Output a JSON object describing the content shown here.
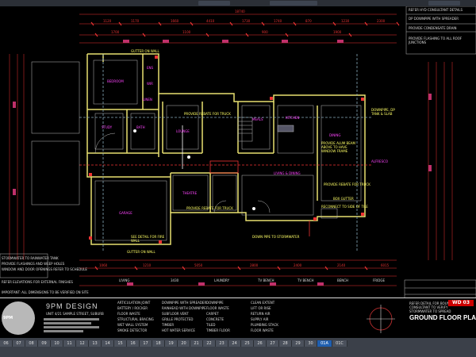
{
  "app": {
    "window_title": "GROUND FLOOR PLAN"
  },
  "dimensions": {
    "overall_top": "18740",
    "top_row": [
      "1120",
      "1170",
      "1660",
      "4410",
      "1730",
      "1740",
      "870",
      "1230",
      "2300",
      "1700",
      "1100",
      "900",
      "1900"
    ],
    "bottom_row": [
      "1060",
      "1210",
      "5050",
      "2800",
      "2400",
      "2140",
      "6015"
    ],
    "bottom_labels": [
      "LIVING",
      "3430",
      "LAUNDRY",
      "TV BENCH",
      "TV BENCH",
      "BENCH",
      "FRIDGE"
    ]
  },
  "rooms": [
    "BEDROOM",
    "STUDY",
    "BATH",
    "LINEN",
    "ENS",
    "WIR",
    "LOUNGE",
    "KITCHEN",
    "DINING",
    "LIVING & DINING",
    "THEATRE",
    "MEALS",
    "ALFRESCO",
    "GARAGE"
  ],
  "notes": [
    "GUTTER ON WALL",
    "PROVIDE REBATE FOR TRUCK",
    "PROVIDE ALUM BEAM ABOVE TO HAVE WINDOW FRAME",
    "PROVIDE REBATE FOR TRUCK",
    "BOX GUTTER",
    "PROVIDE REBATE FOR TRUCK",
    "DOWN PIPE TO STORMWATER",
    "SEE DETAIL FOR FIRE WALL",
    "GUTTER ON WALL",
    "DOWNPIPE, DP TANK & SLAB",
    "RECONNECT TO SIDE OF TILE"
  ],
  "side_notes": [
    "STORMWATER TO RAINWATER TANK",
    "PROVIDE FLASHINGS AND WEEP HOLES",
    "WINDOW AND DOOR OPENINGS REFER TO SCHEDULE",
    "REFER ELEVATIONS FOR EXTERNAL FINISHES",
    "IMPORTANT: ALL DIMENSIONS TO BE VERIFIED ON SITE"
  ],
  "right_notes": [
    "REFER HYD CONSULTANT DETAILS",
    "DP DOWNPIPE WITH SPREADER",
    "PROVIDE CONDENSATE DRAIN",
    "PROVIDE FLASHING TO ALL ROOF JUNCTIONS"
  ],
  "title_block": {
    "logo_label": "9PM",
    "brand": "9PM DESIGN",
    "address": "UNIT 4/21 SAMPLE STREET, SUBURB",
    "legend": [
      "ARTICULATION JOINT",
      "DOWNPIPE WITH SPREADER",
      "DOWNPIPE",
      "CLEAN EXTENT",
      "BATTERY / ROCKER",
      "RAINHEAD WITH DOWNPIPE",
      "FLOOR WASTE",
      "LIFT OR RISE",
      "FLOOR WASTE",
      "SUBFLOOR VENT",
      "CARPET",
      "RETURN AIR",
      "STRUCTURAL BRACING",
      "GRILLE PROTECTED",
      "CONCRETE",
      "SUPPLY AIR",
      "WET WALL SYSTEM",
      "TIMBER",
      "TILED",
      "PLUMBING STACK",
      "SMOKE DETECTOR",
      "HOT WATER SERVICE",
      "TIMBER FLOOR",
      "FLOOR WASTE"
    ],
    "sheet_no": "WD 03",
    "sheet_title": "GROUND FLOOR PLAN",
    "notes": [
      "REFER DETAIL FOR BOUNDARY WALL",
      "CONSULTANT TO VERIFY",
      "STORMWATER TO SPREAD"
    ]
  },
  "layout_tabs": [
    "06",
    "07",
    "08",
    "09",
    "10",
    "11",
    "12",
    "13",
    "14",
    "15",
    "16",
    "17",
    "18",
    "19",
    "20",
    "21",
    "22",
    "23",
    "24",
    "25",
    "26",
    "27",
    "28",
    "29",
    "30",
    "01A",
    "01C"
  ],
  "colors": {
    "line_red": "#e33333",
    "line_yellow": "#e8e070",
    "room_magenta": "#ff44ff",
    "white": "#dddddd",
    "status_bg": "#3b4049",
    "accent": "#1f5fb0"
  }
}
